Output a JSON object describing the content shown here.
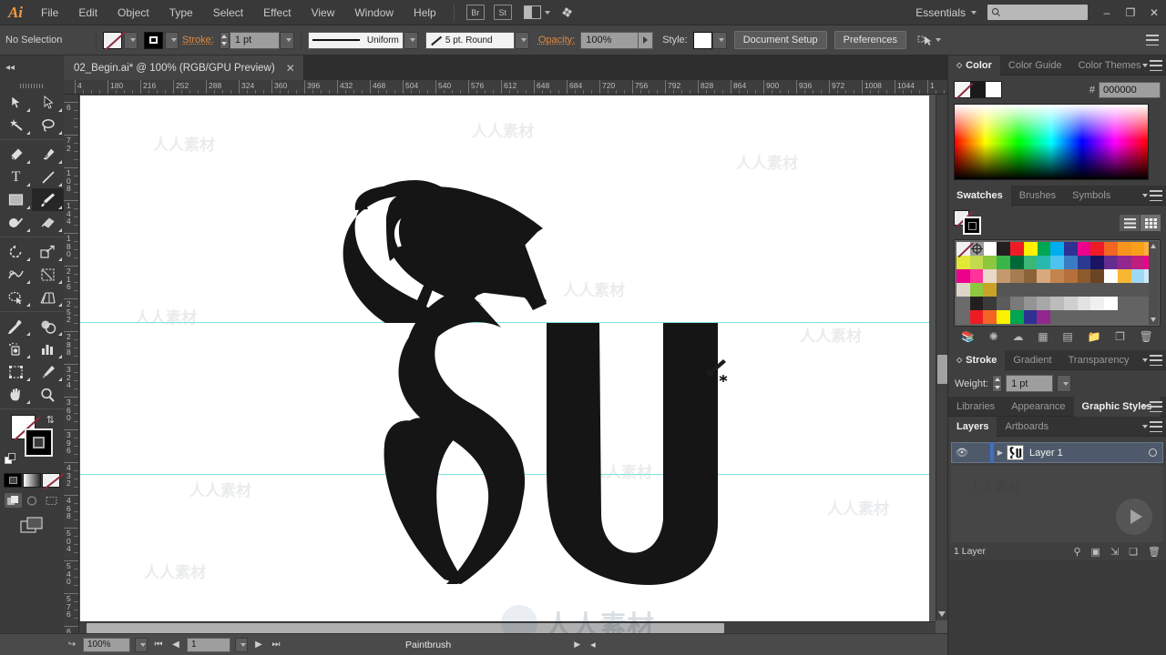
{
  "app": {
    "name": "Adobe Illustrator",
    "logo_text": "Ai"
  },
  "menubar": {
    "items": [
      "File",
      "Edit",
      "Object",
      "Type",
      "Select",
      "Effect",
      "View",
      "Window",
      "Help"
    ],
    "bridge_label": "Br",
    "stock_label": "St",
    "workspace": "Essentials",
    "search_placeholder": "",
    "window_minimize": "–",
    "window_restore": "❐",
    "window_close": "✕"
  },
  "controlbar": {
    "selection_status": "No Selection",
    "stroke_label": "Stroke:",
    "stroke_weight": "1 pt",
    "profile_label": "Uniform",
    "brush_definition": "5 pt. Round",
    "opacity_label": "Opacity:",
    "opacity_value": "100%",
    "style_label": "Style:",
    "document_setup": "Document Setup",
    "preferences": "Preferences"
  },
  "document": {
    "tab_title": "02_Begin.ai* @ 100% (RGB/GPU Preview)",
    "close_glyph": "✕"
  },
  "tools": [
    {
      "name": "selection-tool",
      "glyph": "↖"
    },
    {
      "name": "direct-selection-tool",
      "glyph": "↖"
    },
    {
      "name": "magic-wand-tool",
      "glyph": "✦"
    },
    {
      "name": "lasso-tool",
      "glyph": "☁"
    },
    {
      "name": "pen-tool",
      "glyph": "✒"
    },
    {
      "name": "curvature-tool",
      "glyph": "✎"
    },
    {
      "name": "type-tool",
      "glyph": "T"
    },
    {
      "name": "line-segment-tool",
      "glyph": "╱"
    },
    {
      "name": "rectangle-tool",
      "glyph": "▭"
    },
    {
      "name": "paintbrush-tool",
      "glyph": "✒"
    },
    {
      "name": "shaper-tool",
      "glyph": "◔"
    },
    {
      "name": "eraser-tool",
      "glyph": "▱"
    },
    {
      "name": "rotate-tool",
      "glyph": "↻"
    },
    {
      "name": "scale-tool",
      "glyph": "⤡"
    },
    {
      "name": "width-tool",
      "glyph": "≋"
    },
    {
      "name": "free-transform-tool",
      "glyph": "⌗"
    },
    {
      "name": "shape-builder-tool",
      "glyph": "◑"
    },
    {
      "name": "perspective-grid-tool",
      "glyph": "◥"
    },
    {
      "name": "mesh-tool",
      "glyph": "⌗"
    },
    {
      "name": "gradient-tool",
      "glyph": "▤"
    },
    {
      "name": "eyedropper-tool",
      "glyph": "☂"
    },
    {
      "name": "blend-tool",
      "glyph": "◍"
    },
    {
      "name": "symbol-sprayer-tool",
      "glyph": "⚘"
    },
    {
      "name": "column-graph-tool",
      "glyph": "ᴿ"
    },
    {
      "name": "artboard-tool",
      "glyph": "⬚"
    },
    {
      "name": "slice-tool",
      "glyph": "✁"
    },
    {
      "name": "hand-tool",
      "glyph": "✋"
    },
    {
      "name": "zoom-tool",
      "glyph": "⚲"
    }
  ],
  "active_tool": "paintbrush-tool",
  "ruler": {
    "horizontal_ticks": [
      "4",
      "180",
      "216",
      "252",
      "288",
      "324",
      "360",
      "396",
      "432",
      "468",
      "504",
      "540",
      "576",
      "612",
      "648",
      "684",
      "720",
      "756",
      "792",
      "828",
      "864",
      "900",
      "936",
      "972",
      "1008",
      "1044",
      "1"
    ],
    "vertical_ticks": [
      "6",
      "72",
      "108",
      "144",
      "180",
      "216",
      "252",
      "288",
      "324",
      "360",
      "396",
      "432",
      "468",
      "504",
      "540",
      "576",
      "612"
    ],
    "units": "pt"
  },
  "canvas": {
    "guide_color": "#7fe4de",
    "artwork_description": "blackletter-su-lettering",
    "cursor": "paintbrush-cursor"
  },
  "statusbar": {
    "zoom_level": "100%",
    "artboard_number": "1",
    "tool_status": "Paintbrush",
    "first_glyph": "⏮",
    "prev_glyph": "◀",
    "next_glyph": "▶",
    "last_glyph": "⏭",
    "share_glyph": "↪"
  },
  "panels": {
    "color_group": {
      "tabs": [
        "Color",
        "Color Guide",
        "Color Themes"
      ],
      "active": "Color",
      "hex_symbol": "#",
      "hex_value": "000000",
      "fill_color": "#ffffff",
      "stroke_color": "#000000"
    },
    "swatches_group": {
      "tabs": [
        "Swatches",
        "Brushes",
        "Symbols"
      ],
      "active": "Swatches",
      "rows": [
        [
          "#ffffff",
          "#5a8fb0",
          "#ffffff",
          "#231f20",
          "#ed1c24",
          "#fff200",
          "#00a651",
          "#00aeef",
          "#2e3192",
          "#ec008c",
          "#ed1c24",
          "#f26522",
          "#f7941d",
          "#f9a01b",
          "#fbb040"
        ],
        [
          "#e2e835",
          "#c3d94e",
          "#8dc63f",
          "#39b54a",
          "#006838",
          "#3bb878",
          "#27b9ad",
          "#4ec3f0",
          "#3a7cc4",
          "#2b3990",
          "#1b1464",
          "#662d91",
          "#92278f",
          "#be1e7d",
          "#ec008c"
        ],
        [
          "#ec008c",
          "#ff3399",
          "#e8d9c8",
          "#c49a6c",
          "#a67c52",
          "#8c6239",
          "#d9a87c",
          "#c1854d",
          "#b5703c",
          "#8c5a2b",
          "#6b4423",
          "#ffffff",
          "#f7b733",
          "#9fd8f5",
          "#cfe8f7"
        ],
        [
          "#ddd6c8",
          "#8dc63f",
          "#c9a227",
          "#555555",
          "#555555",
          "#555555",
          "#555555",
          "#555555",
          "#555555",
          "#555555",
          "#555555",
          "#555555",
          "#555555",
          "#555555",
          "#555555"
        ],
        [
          "#6b6b6b",
          "#231f20",
          "#3a3a3a",
          "#5c5c5c",
          "#7a7a7a",
          "#949494",
          "#a8a8a8",
          "#bcbcbc",
          "#cfcfcf",
          "#e2e2e2",
          "#f0f0f0",
          "#ffffff",
          "#636363",
          "#636363",
          "#636363"
        ],
        [
          "#6b6b6b",
          "#ed1c24",
          "#f26522",
          "#fff200",
          "#00a651",
          "#2e3192",
          "#92278f",
          "#636363",
          "#636363",
          "#636363",
          "#636363",
          "#636363",
          "#636363",
          "#636363",
          "#636363"
        ]
      ],
      "footer_icons": [
        "swatch-libraries-icon",
        "color-guide-icon",
        "cloud-icon",
        "new-color-group-icon",
        "swatch-options-icon",
        "folder-icon",
        "new-swatch-icon",
        "delete-swatch-icon"
      ]
    },
    "stroke_group": {
      "tabs": [
        "Stroke",
        "Gradient",
        "Transparency"
      ],
      "active": "Stroke",
      "weight_label": "Weight:",
      "weight_value": "1 pt"
    },
    "libraries_group": {
      "tabs": [
        "Libraries",
        "Appearance",
        "Graphic Styles"
      ],
      "active": "Graphic Styles"
    },
    "layers_group": {
      "tabs": [
        "Layers",
        "Artboards"
      ],
      "active": "Layers",
      "rows": [
        {
          "name": "Layer 1",
          "visible": true,
          "locked": false,
          "color": "#3f6fc4"
        }
      ],
      "footer_count": "1 Layer",
      "footer_icons": [
        "locate-object-icon",
        "make-clipping-mask-icon",
        "create-sublayer-icon",
        "new-layer-icon",
        "delete-layer-icon"
      ]
    }
  },
  "watermark": {
    "text": "人人素材"
  }
}
